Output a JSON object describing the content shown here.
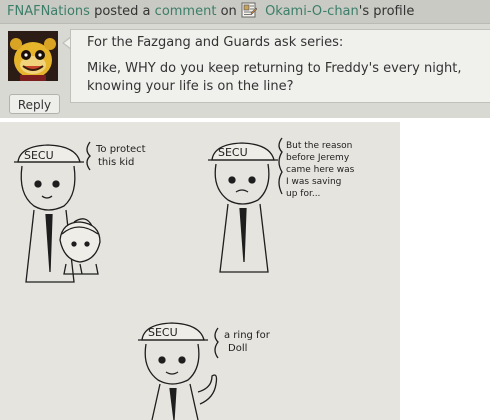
{
  "comment": {
    "author": "FNAFNations",
    "verb": "posted a",
    "object": "comment",
    "preposition": "on",
    "target_owner": "Okami-O-chan",
    "target_suffix": "'s profile",
    "paragraphs": [
      "For the Fazgang and Guards ask series:",
      "Mike, WHY do you keep returning to Freddy's every night, knowing your life is on the line?"
    ],
    "reply_label": "Reply"
  },
  "drawing": {
    "cap_label": "SECU",
    "panels": [
      {
        "note_lines": [
          "To protect",
          "this kid"
        ]
      },
      {
        "note_lines": [
          "But the reason",
          "before Jeremy",
          "came here was",
          "I was saving",
          "up for..."
        ]
      },
      {
        "note_lines": [
          "a ring for",
          "Doll"
        ]
      }
    ]
  },
  "colors": {
    "header_bg": "#c9cac4",
    "card_bg": "#d8d9d3",
    "bubble_bg": "#f0f0ed",
    "link": "#3c7e6a",
    "paper": "#ebe9e4",
    "ink": "#1e1e1e"
  },
  "icons": {
    "profile": "profile-page-icon",
    "avatar": "golden-animatronic-avatar"
  }
}
